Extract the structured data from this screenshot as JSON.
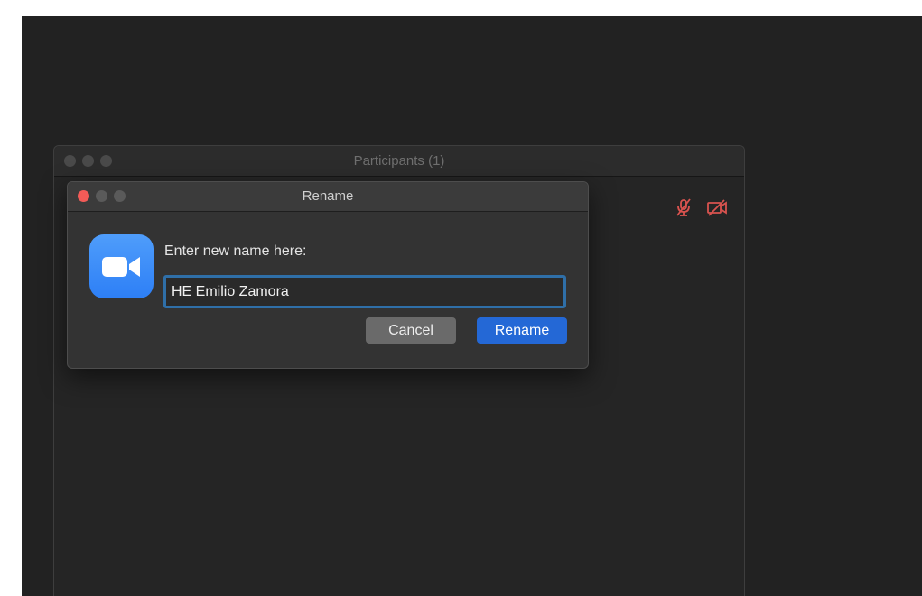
{
  "participants_window": {
    "title": "Participants (1)"
  },
  "status_icons": [
    {
      "icon": "muted-microphone-icon",
      "color": "#d9534f"
    },
    {
      "icon": "video-off-icon",
      "color": "#d9534f"
    }
  ],
  "rename_dialog": {
    "title": "Rename",
    "prompt": "Enter new name here:",
    "name_value": "HE Emilio Zamora",
    "cancel_label": "Cancel",
    "rename_label": "Rename",
    "app_icon": "zoom-camera-icon"
  },
  "colors": {
    "close_button": "#f25b57",
    "primary_button": "#2468d6",
    "input_focus_ring": "#2f6fa8",
    "app_icon_blue": "#2d8cff"
  }
}
